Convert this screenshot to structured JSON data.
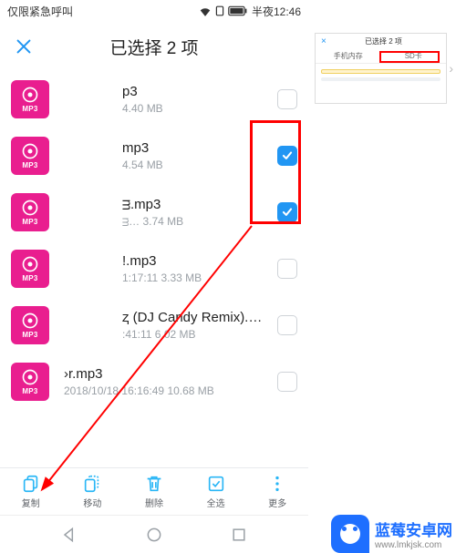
{
  "status": {
    "left_text": "仅限紧急呼叫",
    "time_label": "半夜12:46"
  },
  "header": {
    "title": "已选择 2 项"
  },
  "files": [
    {
      "name": "p3",
      "meta": "4.40 MB",
      "checked": false,
      "alt": false
    },
    {
      "name": "mp3",
      "meta": "4.54 MB",
      "checked": true,
      "alt": false
    },
    {
      "name": "ᴟ.mp3",
      "meta": "ᴟ… 3.74 MB",
      "checked": true,
      "alt": false
    },
    {
      "name": "!.mp3",
      "meta": "1:17:11 3.33 MB",
      "checked": false,
      "alt": false
    },
    {
      "name": "ⱬ (DJ Candy Remix).m…",
      "meta": ":41:11 6.02 MB",
      "checked": false,
      "alt": false
    },
    {
      "name": "›r.mp3",
      "meta": "2018/10/18 16:16:49 10.68 MB",
      "checked": false,
      "alt": true
    }
  ],
  "file_icon_label": "MP3",
  "actions": {
    "copy": "复制",
    "move": "移动",
    "delete": "删除",
    "select_all": "全选",
    "more": "更多"
  },
  "side": {
    "title": "已选择 2 项",
    "tab1": "手机内存",
    "tab2": "SD卡"
  },
  "watermark": {
    "title": "蓝莓安卓网",
    "url": "www.lmkjsk.com"
  }
}
